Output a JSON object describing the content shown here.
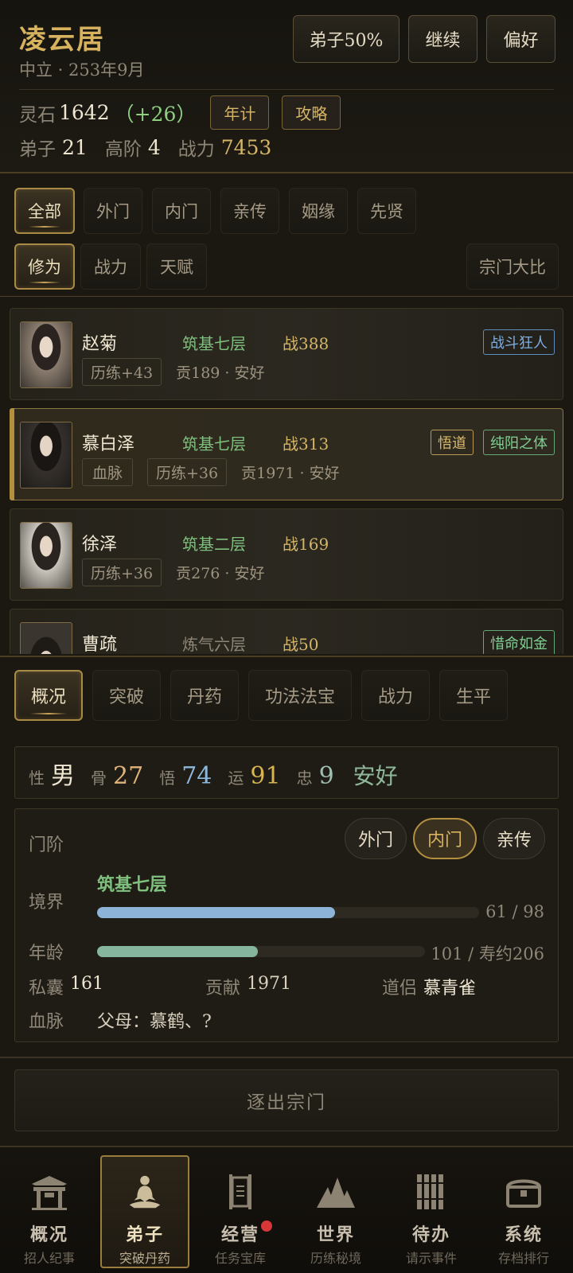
{
  "header": {
    "sect_name": "凌云居",
    "subtitle": "中立 · 253年9月",
    "buttons": {
      "disciple_speed": "弟子50%",
      "continue": "继续",
      "preference": "偏好"
    },
    "spirit_stone_label": "灵石",
    "spirit_stone_value": "1642",
    "spirit_stone_delta": "（+26）",
    "annual_btn": "年计",
    "guide_btn": "攻略",
    "disciples_label": "弟子",
    "disciples_value": "21",
    "senior_label": "高阶",
    "senior_value": "4",
    "power_label": "战力",
    "power_value": "7453"
  },
  "filter_tabs": [
    "全部",
    "外门",
    "内门",
    "亲传",
    "姻缘",
    "先贤"
  ],
  "sort_tabs": [
    "修为",
    "战力",
    "天赋"
  ],
  "tournament_btn": "宗门大比",
  "disciples": [
    {
      "name": "赵菊",
      "realm": "筑基七层",
      "power": "战388",
      "pills": [
        "历练+43"
      ],
      "info": "贡189 · 安好",
      "tags": [
        {
          "text": "战斗狂人",
          "style": "blue"
        }
      ]
    },
    {
      "name": "慕白泽",
      "realm": "筑基七层",
      "power": "战313",
      "pills": [
        "血脉",
        "历练+36"
      ],
      "info": "贡1971 · 安好",
      "tags": [
        {
          "text": "悟道",
          "style": "gold"
        },
        {
          "text": "纯阳之体",
          "style": "green"
        }
      ]
    },
    {
      "name": "徐泽",
      "realm": "筑基二层",
      "power": "战169",
      "pills": [
        "历练+36"
      ],
      "info": "贡276 · 安好",
      "tags": []
    },
    {
      "name": "曹疏",
      "realm": "炼气六层",
      "power": "战50",
      "pills": [],
      "info": "",
      "tags": [
        {
          "text": "惜命如金",
          "style": "green"
        }
      ]
    }
  ],
  "detail_tabs": [
    "概况",
    "突破",
    "丹药",
    "功法法宝",
    "战力",
    "生平"
  ],
  "attributes": {
    "gender_label": "性",
    "gender": "男",
    "bone_label": "骨",
    "bone": "27",
    "insight_label": "悟",
    "insight": "74",
    "luck_label": "运",
    "luck": "91",
    "loyalty_label": "忠",
    "loyalty": "9",
    "status": "安好"
  },
  "detail": {
    "rank_label": "门阶",
    "rank_options": [
      "外门",
      "内门",
      "亲传"
    ],
    "realm_label": "境界",
    "realm_value": "筑基七层",
    "realm_progress_text": "61 / 98",
    "realm_progress": 0.622,
    "age_label": "年龄",
    "age_text": "101 / 寿约206",
    "age_progress": 0.49,
    "purse_label": "私囊",
    "purse_value": "161",
    "contribution_label": "贡献",
    "contribution_value": "1971",
    "partner_label": "道侣",
    "partner_value": "慕青雀",
    "bloodline_label": "血脉",
    "bloodline_value": "父母：慕鹤、?"
  },
  "expel_btn": "逐出宗门",
  "nav": [
    {
      "title": "概况",
      "sub": "招人纪事"
    },
    {
      "title": "弟子",
      "sub": "突破丹药"
    },
    {
      "title": "经营",
      "sub": "任务宝库"
    },
    {
      "title": "世界",
      "sub": "历练秘境"
    },
    {
      "title": "待办",
      "sub": "请示事件"
    },
    {
      "title": "系统",
      "sub": "存档排行"
    }
  ],
  "colors": {
    "gold": "#d4b467",
    "green": "#7fc07e",
    "realm_bar": "#8db4d6",
    "age_bar": "#86b59d"
  }
}
